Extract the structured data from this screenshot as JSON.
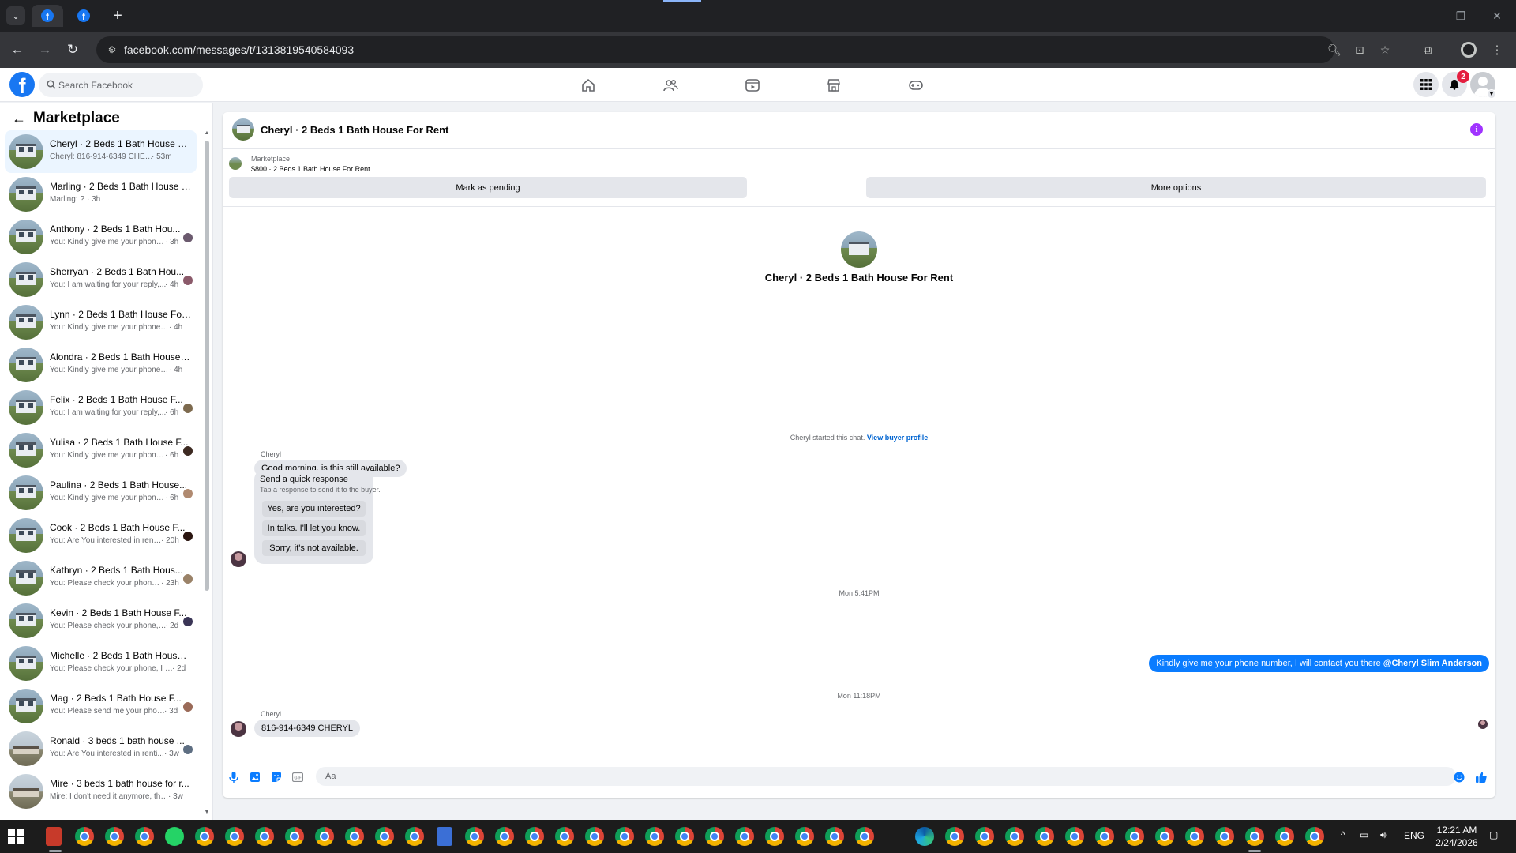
{
  "browser": {
    "url": "facebook.com/messages/t/1313819540584093",
    "tabs": [
      {
        "icon": "facebook-icon",
        "active": true
      },
      {
        "icon": "facebook-icon",
        "active": false
      }
    ]
  },
  "fb_header": {
    "logo": "f",
    "search_placeholder": "Search Facebook",
    "nav_icons": [
      "home-icon",
      "friends-icon",
      "video-icon",
      "marketplace-icon",
      "gaming-icon"
    ],
    "notification_count": "2"
  },
  "sidebar": {
    "title": "Marketplace",
    "conversations": [
      {
        "title": "Cheryl · 2 Beds 1 Bath House Fo...",
        "preview": "Cheryl: 816-914-6349 CHERYL",
        "time": "· 53m",
        "selected": true
      },
      {
        "title": "Marling · 2 Beds 1 Bath House F...",
        "preview": "Marling: ?",
        "time": "· 3h"
      },
      {
        "title": "Anthony · 2 Beds 1 Bath Hou...",
        "preview": "You: Kindly give me your phone...",
        "time": "· 3h"
      },
      {
        "title": "Sherryan · 2 Beds 1 Bath Hou...",
        "preview": "You: I am waiting for your reply,...",
        "time": "· 4h"
      },
      {
        "title": "Lynn · 2 Beds 1 Bath House For ...",
        "preview": "You: Kindly give me your phone n...",
        "time": "· 4h"
      },
      {
        "title": "Alondra · 2 Beds 1 Bath House F...",
        "preview": "You: Kindly give me your phone n...",
        "time": "· 4h"
      },
      {
        "title": "Felix · 2 Beds 1 Bath House F...",
        "preview": "You: I am waiting for your reply,...",
        "time": "· 6h"
      },
      {
        "title": "Yulisa · 2 Beds 1 Bath House F...",
        "preview": "You: Kindly give me your phone...",
        "time": "· 6h"
      },
      {
        "title": "Paulina · 2 Beds 1 Bath House...",
        "preview": "You: Kindly give me your phone...",
        "time": "· 6h"
      },
      {
        "title": "Cook · 2 Beds 1 Bath House F...",
        "preview": "You: Are You interested in rent...",
        "time": "· 20h"
      },
      {
        "title": "Kathryn · 2 Beds 1 Bath Hous...",
        "preview": "You: Please check your phone, ...",
        "time": "· 23h"
      },
      {
        "title": "Kevin · 2 Beds 1 Bath House F...",
        "preview": "You: Please check your phone, I...",
        "time": "· 2d"
      },
      {
        "title": "Michelle · 2 Beds 1 Bath House ...",
        "preview": "You: Please check your phone, I ha...",
        "time": "· 2d"
      },
      {
        "title": "Mag · 2 Beds 1 Bath House F...",
        "preview": "You: Please send me your phon...",
        "time": "· 3d"
      },
      {
        "title": "Ronald · 3 beds 1 bath house ...",
        "preview": "You: Are You interested in renti...",
        "time": "· 3w"
      },
      {
        "title": "Mire · 3 beds 1 bath house for r...",
        "preview": "Mire: I don't need it anymore, tha...",
        "time": "· 3w"
      }
    ]
  },
  "chat": {
    "title": "Cheryl · 2 Beds 1 Bath House For Rent",
    "listing_source": "Marketplace",
    "listing_title": "$800 · 2 Beds 1 Bath House For Rent",
    "btn_pending": "Mark as pending",
    "btn_more": "More options",
    "intro_name": "Cheryl · 2 Beds 1 Bath House For Rent",
    "started_text": "Cheryl started this chat.",
    "view_profile": "View buyer profile",
    "sender_name": "Cheryl",
    "first_message": "Good morning, is this still available?",
    "quick_title": "Send a quick response",
    "quick_sub": "Tap a response to send it to the buyer.",
    "quick_options": [
      "Yes, are you interested?",
      "In talks. I'll let you know.",
      "Sorry, it's not available."
    ],
    "timestamp_1": "Mon 5:41PM",
    "out_message": "Kindly give me your phone number, I will contact you there",
    "out_mention": "@Cheryl Slim Anderson",
    "timestamp_2": "Mon 11:18PM",
    "last_message": "816-914-6349 CHERYL",
    "composer_placeholder": "Aa"
  },
  "taskbar": {
    "time": "12:21 AM",
    "date": "2/24/2026",
    "language": "ENG"
  },
  "colors": {
    "brand": "#1877f2",
    "messenger_blue": "#0a7cff",
    "selected_row": "#ebf5ff"
  }
}
